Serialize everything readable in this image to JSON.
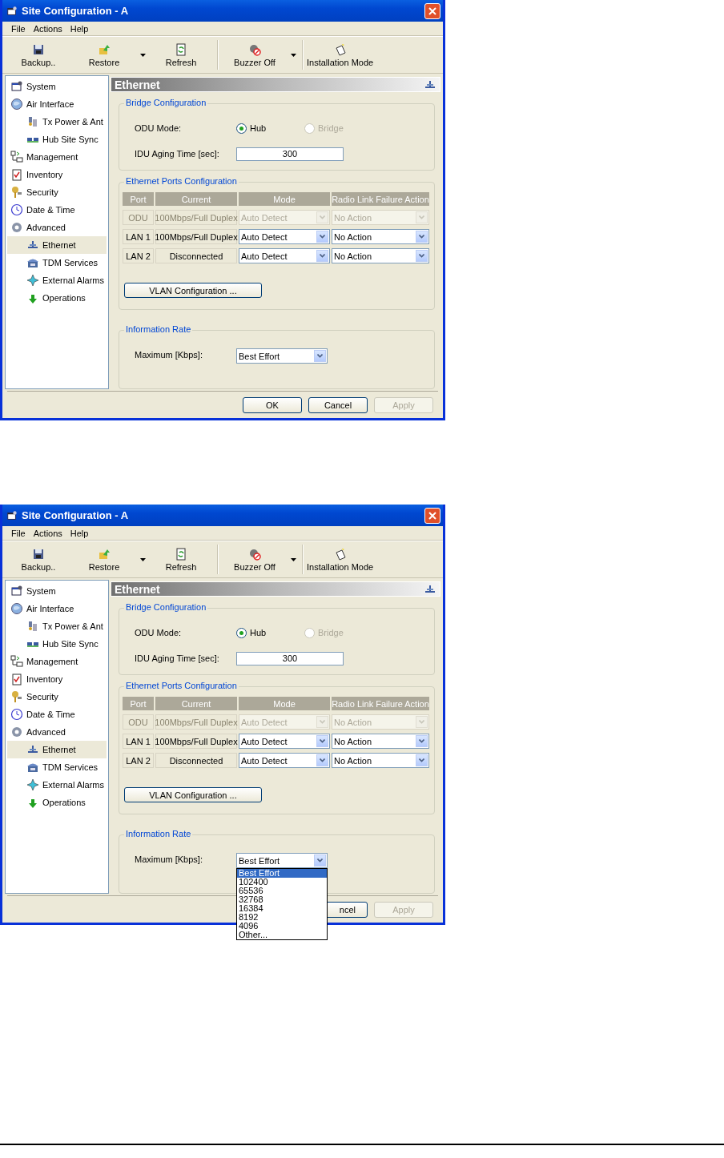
{
  "screenshots": [
    {
      "window": {
        "title": "Site Configuration - A"
      },
      "menu": [
        "File",
        "Actions",
        "Help"
      ],
      "toolbar": [
        {
          "kind": "button",
          "label": "Backup.."
        },
        {
          "kind": "button",
          "label": "Restore"
        },
        {
          "kind": "dropdown"
        },
        {
          "kind": "button",
          "label": "Refresh"
        },
        {
          "kind": "separator"
        },
        {
          "kind": "button",
          "label": "Buzzer Off"
        },
        {
          "kind": "dropdown"
        },
        {
          "kind": "separator"
        },
        {
          "kind": "button",
          "label": "Installation Mode"
        }
      ],
      "sidebar": {
        "items": [
          {
            "label": "System",
            "selected": false
          },
          {
            "label": "Air Interface",
            "selected": false,
            "children": [
              {
                "label": "Tx Power & Ant",
                "selected": false
              },
              {
                "label": "Hub Site Sync",
                "selected": false
              }
            ]
          },
          {
            "label": "Management",
            "selected": false
          },
          {
            "label": "Inventory",
            "selected": false
          },
          {
            "label": "Security",
            "selected": false
          },
          {
            "label": "Date & Time",
            "selected": false
          },
          {
            "label": "Advanced",
            "selected": false,
            "children": [
              {
                "label": "Ethernet",
                "selected": true
              },
              {
                "label": "TDM Services",
                "selected": false
              },
              {
                "label": "External Alarms",
                "selected": false
              },
              {
                "label": "Operations",
                "selected": false
              }
            ]
          }
        ]
      },
      "panel": {
        "title": "Ethernet",
        "bridge_configuration": {
          "title": "Bridge Configuration",
          "odu_mode": {
            "label": "ODU Mode:",
            "options": [
              {
                "label": "Hub",
                "selected": true,
                "disabled": false
              },
              {
                "label": "Bridge",
                "selected": false,
                "disabled": true
              }
            ]
          },
          "aging_time": {
            "label": "IDU Aging Time [sec]:",
            "value": "300"
          }
        },
        "ports": {
          "title": "Ethernet Ports Configuration",
          "columns": [
            "Port",
            "Current",
            "Mode",
            "Radio Link Failure Action"
          ],
          "rows": [
            {
              "port": "ODU",
              "current": "100Mbps/Full Duplex",
              "mode": "Auto Detect",
              "action": "No Action",
              "disabled": true
            },
            {
              "port": "LAN 1",
              "current": "100Mbps/Full Duplex",
              "mode": "Auto Detect",
              "action": "No Action",
              "disabled": false
            },
            {
              "port": "LAN 2",
              "current": "Disconnected",
              "mode": "Auto Detect",
              "action": "No Action",
              "disabled": false
            }
          ],
          "vlan_button": "VLAN Configuration ..."
        },
        "information_rate": {
          "title": "Information Rate",
          "label": "Maximum [Kbps]:",
          "value": "Best Effort"
        }
      },
      "buttons": [
        {
          "label": "OK",
          "disabled": false
        },
        {
          "label": "Cancel",
          "disabled": false
        },
        {
          "label": "Apply",
          "disabled": true
        }
      ]
    },
    {
      "window": {
        "title": "Site Configuration - A"
      },
      "menu": [
        "File",
        "Actions",
        "Help"
      ],
      "toolbar": [
        {
          "kind": "button",
          "label": "Backup.."
        },
        {
          "kind": "button",
          "label": "Restore"
        },
        {
          "kind": "dropdown"
        },
        {
          "kind": "button",
          "label": "Refresh"
        },
        {
          "kind": "separator"
        },
        {
          "kind": "button",
          "label": "Buzzer Off"
        },
        {
          "kind": "dropdown"
        },
        {
          "kind": "separator"
        },
        {
          "kind": "button",
          "label": "Installation Mode"
        }
      ],
      "sidebar": {
        "items": [
          {
            "label": "System",
            "selected": false
          },
          {
            "label": "Air Interface",
            "selected": false,
            "children": [
              {
                "label": "Tx Power & Ant",
                "selected": false
              },
              {
                "label": "Hub Site Sync",
                "selected": false
              }
            ]
          },
          {
            "label": "Management",
            "selected": false
          },
          {
            "label": "Inventory",
            "selected": false
          },
          {
            "label": "Security",
            "selected": false
          },
          {
            "label": "Date & Time",
            "selected": false
          },
          {
            "label": "Advanced",
            "selected": false,
            "children": [
              {
                "label": "Ethernet",
                "selected": true
              },
              {
                "label": "TDM Services",
                "selected": false
              },
              {
                "label": "External Alarms",
                "selected": false
              },
              {
                "label": "Operations",
                "selected": false
              }
            ]
          }
        ]
      },
      "panel": {
        "title": "Ethernet",
        "bridge_configuration": {
          "title": "Bridge Configuration",
          "odu_mode": {
            "label": "ODU Mode:",
            "options": [
              {
                "label": "Hub",
                "selected": true,
                "disabled": false
              },
              {
                "label": "Bridge",
                "selected": false,
                "disabled": true
              }
            ]
          },
          "aging_time": {
            "label": "IDU Aging Time [sec]:",
            "value": "300"
          }
        },
        "ports": {
          "title": "Ethernet Ports Configuration",
          "columns": [
            "Port",
            "Current",
            "Mode",
            "Radio Link Failure Action"
          ],
          "rows": [
            {
              "port": "ODU",
              "current": "100Mbps/Full Duplex",
              "mode": "Auto Detect",
              "action": "No Action",
              "disabled": true
            },
            {
              "port": "LAN 1",
              "current": "100Mbps/Full Duplex",
              "mode": "Auto Detect",
              "action": "No Action",
              "disabled": false
            },
            {
              "port": "LAN 2",
              "current": "Disconnected",
              "mode": "Auto Detect",
              "action": "No Action",
              "disabled": false
            }
          ],
          "vlan_button": "VLAN Configuration ..."
        },
        "information_rate": {
          "title": "Information Rate",
          "label": "Maximum [Kbps]:",
          "value": "Best Effort",
          "open_list": [
            {
              "label": "Best Effort",
              "selected": true
            },
            {
              "label": "102400",
              "selected": false
            },
            {
              "label": "65536",
              "selected": false
            },
            {
              "label": "32768",
              "selected": false
            },
            {
              "label": "16384",
              "selected": false
            },
            {
              "label": "8192",
              "selected": false
            },
            {
              "label": "4096",
              "selected": false
            },
            {
              "label": "Other...",
              "selected": false
            }
          ]
        }
      },
      "buttons": [
        {
          "label": "ncel",
          "disabled": false
        },
        {
          "label": "Apply",
          "disabled": true
        }
      ]
    }
  ]
}
